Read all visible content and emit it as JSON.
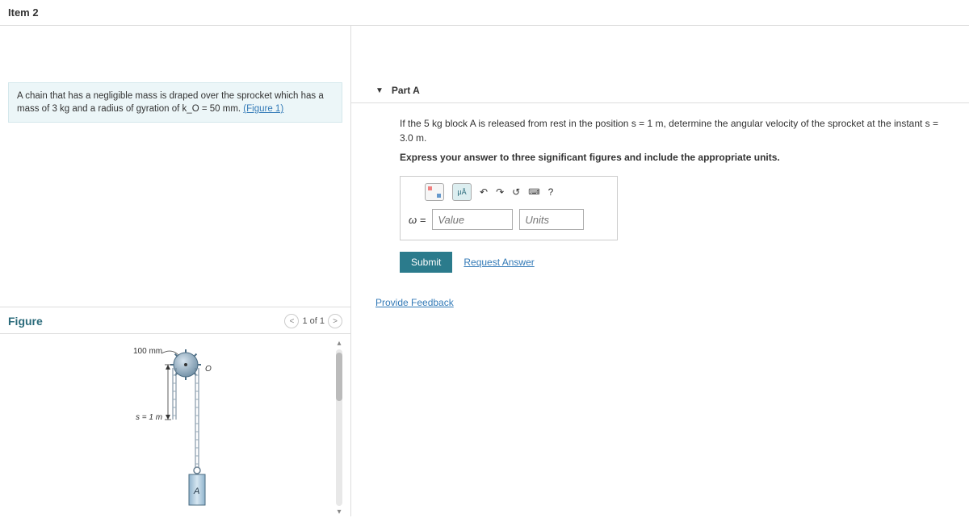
{
  "header": {
    "item_title": "Item 2"
  },
  "problem": {
    "text_before_link": "A chain that has a negligible mass is draped over the sprocket which has a mass of 3 kg and a radius of gyration of k_O = 50 mm. ",
    "figure_link": "(Figure 1)"
  },
  "figure": {
    "title": "Figure",
    "nav_label": "1 of 1",
    "radius_label": "100 mm",
    "s_label": "s = 1 m",
    "block_label": "A",
    "center_label": "O"
  },
  "part": {
    "label": "Part A",
    "question_line1": "If the 5 kg block A is released from rest in the position s = 1 m, determine the angular velocity of the sprocket at the instant s = 3.0 m.",
    "question_line2": "Express your answer to three significant figures and include the appropriate units.",
    "variable": "ω =",
    "value_placeholder": "Value",
    "units_placeholder": "Units",
    "submit_label": "Submit",
    "request_answer": "Request Answer",
    "toolbar": {
      "units_btn": "μÅ",
      "undo": "↶",
      "redo": "↷",
      "reset": "↺",
      "keyboard": "⌨",
      "help": "?"
    }
  },
  "feedback": {
    "label": "Provide Feedback"
  }
}
